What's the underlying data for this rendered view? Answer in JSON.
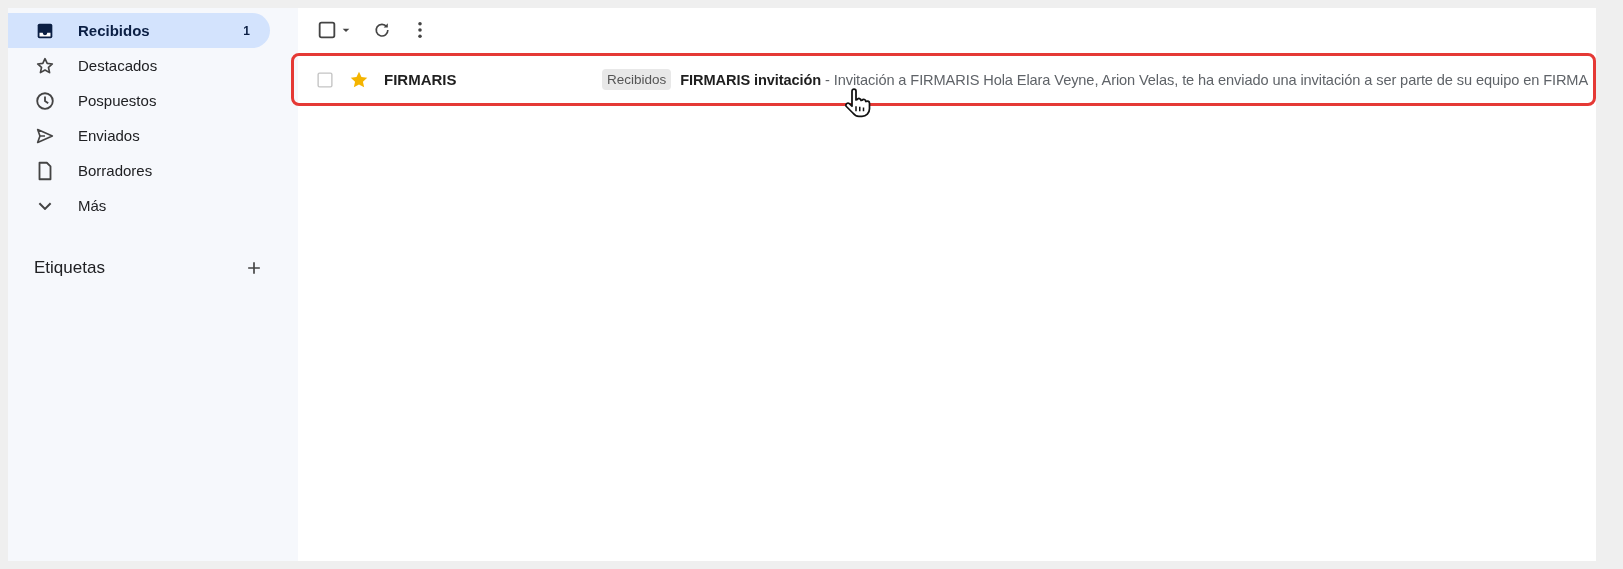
{
  "sidebar": {
    "items": [
      {
        "label": "Recibidos",
        "count": "1",
        "selected": true
      },
      {
        "label": "Destacados",
        "selected": false
      },
      {
        "label": "Pospuestos",
        "selected": false
      },
      {
        "label": "Enviados",
        "selected": false
      },
      {
        "label": "Borradores",
        "selected": false
      },
      {
        "label": "Más",
        "selected": false
      }
    ],
    "labels_heading": "Etiquetas"
  },
  "toolbar": {
    "select_all_checked": false
  },
  "messages": [
    {
      "sender": "FIRMARIS",
      "checked": false,
      "starred": true,
      "unread": true,
      "highlighted": true,
      "tag": "Recibidos",
      "subject": "FIRMARIS invitación",
      "snippet": " - Invitación a FIRMARIS Hola Elara Veyne, Arion Velas, te ha enviado una invitación a ser parte de su equipo en FIRMA"
    }
  ]
}
